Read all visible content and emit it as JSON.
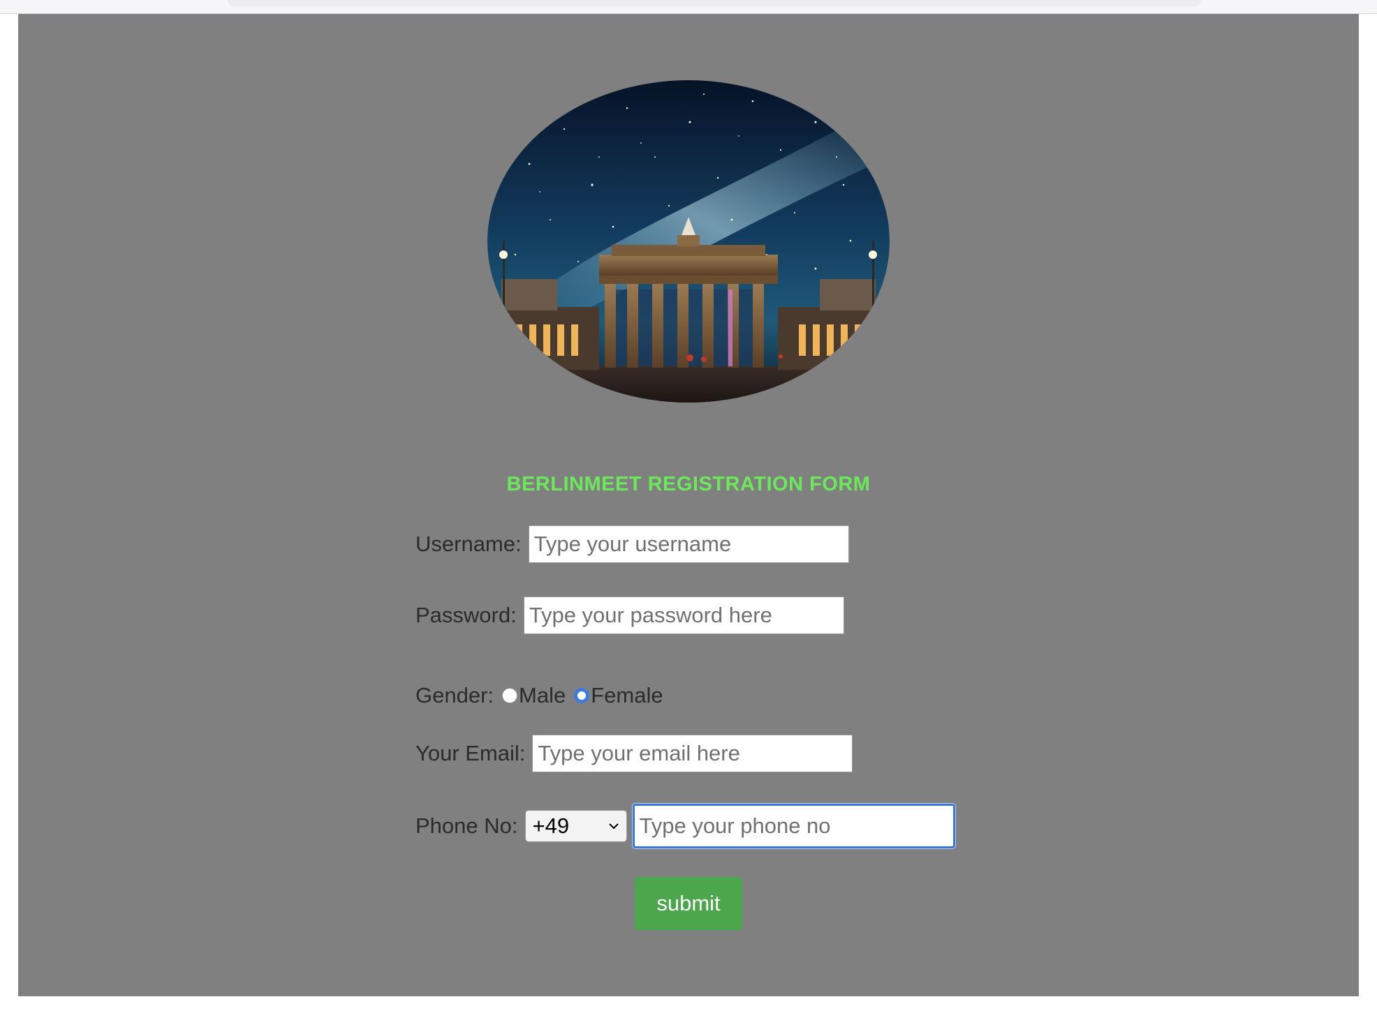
{
  "form": {
    "title": "BERLINMEET REGISTRATION FORM",
    "title_color": "#6be95a",
    "hero_image": "brandenburg-gate-night-sky",
    "username": {
      "label": "Username:",
      "placeholder": "Type your username",
      "value": ""
    },
    "password": {
      "label": "Password:",
      "placeholder": "Type your password here",
      "value": ""
    },
    "gender": {
      "label": "Gender:",
      "options": [
        "Male",
        "Female"
      ],
      "selected": "Female"
    },
    "email": {
      "label": "Your Email:",
      "placeholder": "Type your email here",
      "value": ""
    },
    "phone": {
      "label": "Phone No:",
      "country_code": "+49",
      "placeholder": "Type your phone no",
      "value": ""
    },
    "submit_label": "submit",
    "submit_color": "#4ca64c"
  },
  "colors": {
    "page_background": "#808080",
    "focus_ring": "#3d78d8"
  }
}
